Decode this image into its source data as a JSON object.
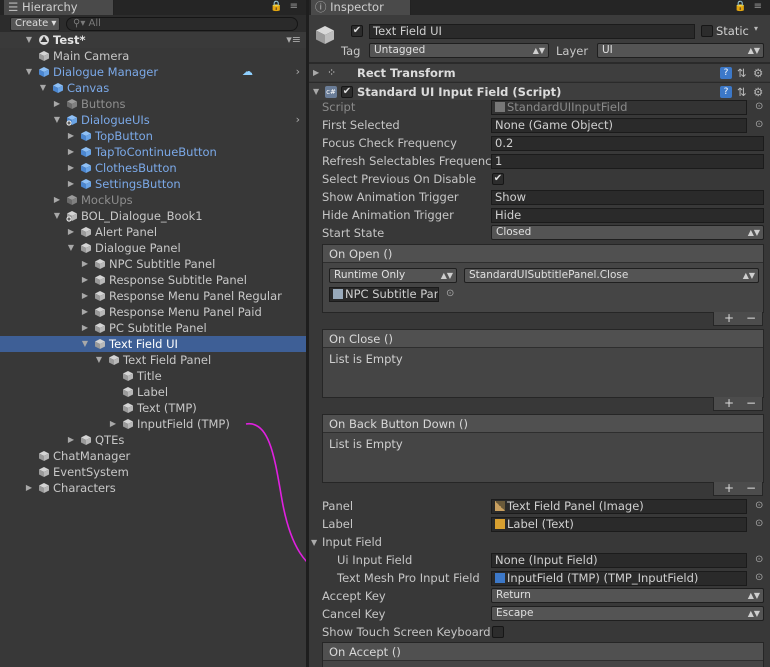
{
  "hierarchy": {
    "tab_label": "Hierarchy",
    "create_label": "Create",
    "search_placeholder": "All",
    "scene_name": "Test*",
    "rows": [
      {
        "label": "Main Camera",
        "style": "normal"
      },
      {
        "label": "Dialogue Manager",
        "style": "blue"
      },
      {
        "label": "Canvas",
        "style": "blue"
      },
      {
        "label": "Buttons",
        "style": "dim"
      },
      {
        "label": "DialogueUIs",
        "style": "blue"
      },
      {
        "label": "TopButton",
        "style": "blue"
      },
      {
        "label": "TapToContinueButton",
        "style": "blue"
      },
      {
        "label": "ClothesButton",
        "style": "blue"
      },
      {
        "label": "SettingsButton",
        "style": "blue"
      },
      {
        "label": "MockUps",
        "style": "dim"
      },
      {
        "label": "BOL_Dialogue_Book1",
        "style": "normal"
      },
      {
        "label": "Alert Panel",
        "style": "normal"
      },
      {
        "label": "Dialogue Panel",
        "style": "normal"
      },
      {
        "label": "NPC Subtitle Panel",
        "style": "normal"
      },
      {
        "label": "Response Subtitle Panel",
        "style": "normal"
      },
      {
        "label": "Response Menu Panel Regular",
        "style": "normal"
      },
      {
        "label": "Response Menu Panel Paid",
        "style": "normal"
      },
      {
        "label": "PC Subtitle Panel",
        "style": "normal"
      },
      {
        "label": "Text Field UI",
        "style": "selected"
      },
      {
        "label": "Text Field Panel",
        "style": "normal"
      },
      {
        "label": "Title",
        "style": "normal"
      },
      {
        "label": "Label",
        "style": "normal"
      },
      {
        "label": "Text (TMP)",
        "style": "normal"
      },
      {
        "label": "InputField (TMP)",
        "style": "normal"
      },
      {
        "label": "QTEs",
        "style": "normal"
      },
      {
        "label": "ChatManager",
        "style": "normal"
      },
      {
        "label": "EventSystem",
        "style": "normal"
      },
      {
        "label": "Characters",
        "style": "normal"
      }
    ]
  },
  "inspector": {
    "tab_label": "Inspector",
    "object_name": "Text Field UI",
    "static_label": "Static",
    "tag_label": "Tag",
    "tag_value": "Untagged",
    "layer_label": "Layer",
    "layer_value": "UI",
    "rect_transform_label": "Rect Transform",
    "component_label": "Standard UI Input Field (Script)",
    "props": {
      "script_label": "Script",
      "script_value": "StandardUIInputField",
      "first_selected_label": "First Selected",
      "first_selected_value": "None (Game Object)",
      "focus_label": "Focus Check Frequency",
      "focus_value": "0.2",
      "refresh_label": "Refresh Selectables Frequenc",
      "refresh_value": "1",
      "select_prev_label": "Select Previous On Disable",
      "show_anim_label": "Show Animation Trigger",
      "show_anim_value": "Show",
      "hide_anim_label": "Hide Animation Trigger",
      "hide_anim_value": "Hide",
      "start_state_label": "Start State",
      "start_state_value": "Closed"
    },
    "on_open": {
      "title": "On Open ()",
      "runtime": "Runtime Only",
      "function": "StandardUISubtitlePanel.Close",
      "target": "NPC Subtitle Par"
    },
    "on_close": {
      "title": "On Close ()",
      "empty": "List is Empty"
    },
    "on_back": {
      "title": "On Back Button Down ()",
      "empty": "List is Empty"
    },
    "lower": {
      "panel_label": "Panel",
      "panel_value": "Text Field Panel (Image)",
      "label_label": "Label",
      "label_value": "Label (Text)",
      "input_field_label": "Input Field",
      "ui_input_label": "Ui Input Field",
      "ui_input_value": "None (Input Field)",
      "tmp_input_label": "Text Mesh Pro Input Field",
      "tmp_input_value": "InputField (TMP) (TMP_InputField)",
      "accept_key_label": "Accept Key",
      "accept_key_value": "Return",
      "cancel_key_label": "Cancel Key",
      "cancel_key_value": "Escape",
      "touch_kb_label": "Show Touch Screen Keyboard"
    },
    "on_accept": {
      "title": "On Accept ()"
    }
  },
  "colors": {
    "selection": "#3e5f96",
    "prefab_blue": "#7ba9e8",
    "arrow": "#e020e0"
  }
}
